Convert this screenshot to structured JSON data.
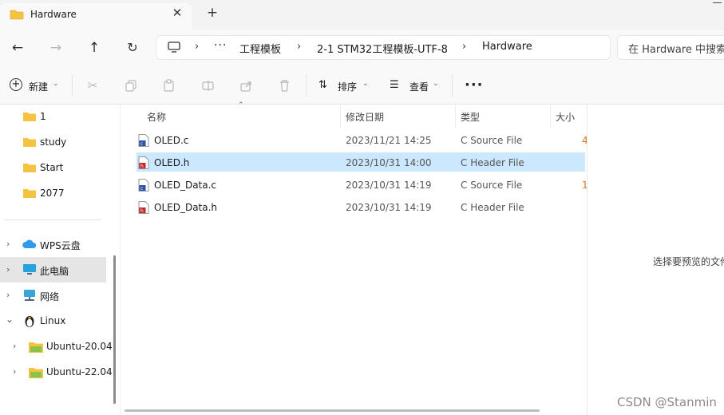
{
  "tab": {
    "title": "Hardware",
    "close_glyph": "✕",
    "new_tab_glyph": "+"
  },
  "window": {
    "minimize_glyph": "—"
  },
  "nav_buttons": {
    "back": "←",
    "forward": "→",
    "up": "↑",
    "refresh": "↻"
  },
  "breadcrumb": {
    "separator": "›",
    "ellipsis": "···",
    "items": [
      "工程模板",
      "2-1 STM32工程模板-UTF-8",
      "Hardware"
    ]
  },
  "search": {
    "placeholder": "在 Hardware 中搜索"
  },
  "toolbar": {
    "new_label": "新建",
    "new_glyph": "+",
    "sort_label": "排序",
    "view_label": "查看",
    "more_label": "···",
    "chevron": "⌄"
  },
  "nav": {
    "quick_items": [
      {
        "label": "1",
        "icon": "folder-icon"
      },
      {
        "label": "study",
        "icon": "folder-icon"
      },
      {
        "label": "Start",
        "icon": "folder-icon"
      },
      {
        "label": "2077",
        "icon": "folder-icon"
      }
    ],
    "tree_items": [
      {
        "label": "WPS云盘",
        "icon": "cloud-icon",
        "expander": "›"
      },
      {
        "label": "此电脑",
        "icon": "computer-icon",
        "expander": "›"
      },
      {
        "label": "网络",
        "icon": "network-icon",
        "expander": "›"
      },
      {
        "label": "Linux",
        "icon": "linux-penguin-icon",
        "expander": "⌄"
      },
      {
        "label": "Ubuntu-20.04",
        "icon": "folder-icon",
        "expander": "›"
      },
      {
        "label": "Ubuntu-22.04",
        "icon": "folder-icon",
        "expander": "›"
      }
    ]
  },
  "columns": {
    "name": "名称",
    "modified": "修改日期",
    "type": "类型",
    "size": "大小"
  },
  "files": [
    {
      "name": "OLED.c",
      "modified": "2023/11/21 14:25",
      "type": "C Source File",
      "size": "4",
      "kind": "c-source",
      "selected": false
    },
    {
      "name": "OLED.h",
      "modified": "2023/10/31 14:00",
      "type": "C Header File",
      "size": "",
      "kind": "c-header",
      "selected": true
    },
    {
      "name": "OLED_Data.c",
      "modified": "2023/10/31 14:19",
      "type": "C Source File",
      "size": "1",
      "kind": "c-source",
      "selected": false
    },
    {
      "name": "OLED_Data.h",
      "modified": "2023/10/31 14:19",
      "type": "C Header File",
      "size": "",
      "kind": "c-header",
      "selected": false
    }
  ],
  "preview": {
    "text": "选择要预览的文件"
  },
  "watermark": "CSDN @Stanmin",
  "colors": {
    "accent_folder": "#f5c342",
    "selection": "#cce8ff",
    "size_text": "#d1781c"
  }
}
